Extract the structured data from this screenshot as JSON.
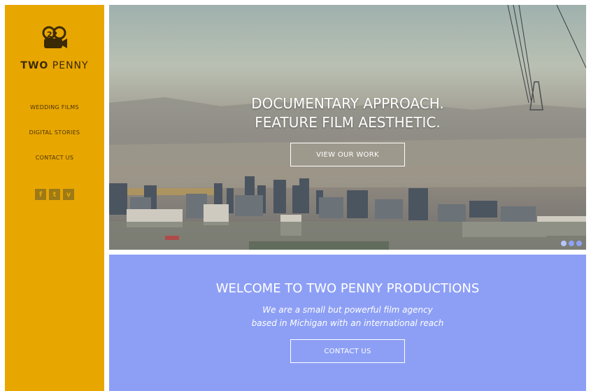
{
  "brand": {
    "logo_mark": "22",
    "name_bold": "TWO",
    "name_light": " PENNY"
  },
  "nav": {
    "items": [
      "WEDDING FILMS",
      "DIGITAL STORIES",
      "CONTACT US"
    ]
  },
  "social": {
    "icons": [
      "facebook-icon",
      "twitter-icon",
      "vimeo-icon"
    ],
    "glyphs": [
      "f",
      "t",
      "v"
    ]
  },
  "hero": {
    "title_line1": "DOCUMENTARY APPROACH.",
    "title_line2": "FEATURE FILM AESTHETIC.",
    "button_label": "VIEW OUR WORK",
    "slide_count": 3,
    "active_slide": 1
  },
  "welcome": {
    "title": "WELCOME TO TWO PENNY PRODUCTIONS",
    "subtitle_line1": "We are a small but powerful film agency",
    "subtitle_line2": "based in Michigan with an international reach",
    "button_label": "CONTACT US"
  },
  "colors": {
    "sidebar": "#e8a600",
    "welcome_bg": "#8d9ff5",
    "text_dark": "#3b2a06"
  }
}
